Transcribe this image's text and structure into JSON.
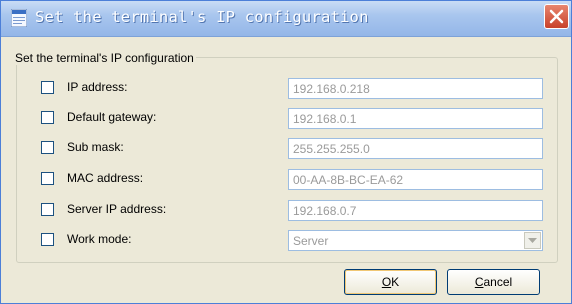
{
  "window": {
    "title": "Set the terminal's IP configuration"
  },
  "group": {
    "label": "Set the terminal's IP configuration"
  },
  "fields": [
    {
      "label": "IP address:",
      "value": "192.168.0.218"
    },
    {
      "label": "Default gateway:",
      "value": "192.168.0.1"
    },
    {
      "label": "Sub mask:",
      "value": "255.255.255.0"
    },
    {
      "label": "MAC address:",
      "value": "00-AA-8B-BC-EA-62"
    },
    {
      "label": "Server IP address:",
      "value": "192.168.0.7"
    }
  ],
  "work_mode": {
    "label": "Work mode:",
    "value": "Server"
  },
  "buttons": {
    "ok_mnemonic": "O",
    "ok_rest": "K",
    "cancel_mnemonic": "C",
    "cancel_rest": "ancel"
  }
}
